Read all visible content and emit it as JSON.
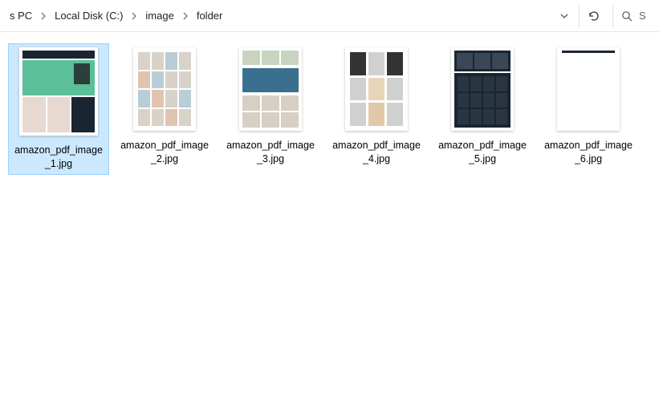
{
  "breadcrumb": {
    "items": [
      "s PC",
      "Local Disk (C:)",
      "image",
      "folder"
    ]
  },
  "search": {
    "placeholder": "S"
  },
  "files": [
    {
      "name": "amazon_pdf_image_1.jpg",
      "selected": true
    },
    {
      "name": "amazon_pdf_image_2.jpg",
      "selected": false
    },
    {
      "name": "amazon_pdf_image_3.jpg",
      "selected": false
    },
    {
      "name": "amazon_pdf_image_4.jpg",
      "selected": false
    },
    {
      "name": "amazon_pdf_image_5.jpg",
      "selected": false
    },
    {
      "name": "amazon_pdf_image_6.jpg",
      "selected": false
    }
  ],
  "icons": {
    "chevron": "chevron-right-icon",
    "dropdown": "chevron-down-icon",
    "refresh": "refresh-icon",
    "search": "search-icon"
  }
}
